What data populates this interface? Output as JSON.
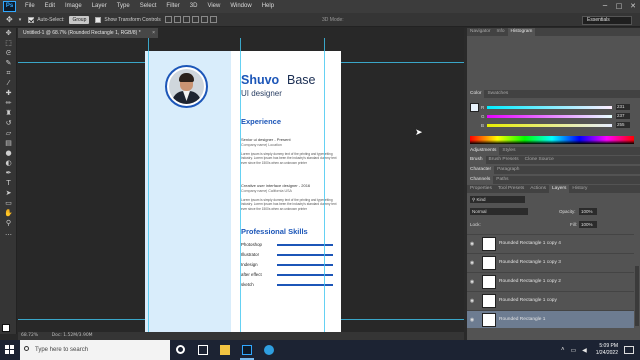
{
  "app": {
    "logo": "Ps"
  },
  "menubar": {
    "items": [
      "File",
      "Edit",
      "Image",
      "Layer",
      "Type",
      "Select",
      "Filter",
      "3D",
      "View",
      "Window",
      "Help"
    ]
  },
  "window_controls": [
    "─",
    "□",
    "✕"
  ],
  "options_bar": {
    "auto_select_label": "Auto-Select:",
    "auto_select_value": "Group",
    "transform_label": "Show Transform Controls",
    "mode_3d_label": "3D Mode:",
    "workspace": "Essentials"
  },
  "document": {
    "tab_title": "Untitled-1 @ 68.7% (Rounded Rectangle 1, RGB/8) *",
    "close_glyph": "×"
  },
  "resume": {
    "name_first": "Shuvo",
    "name_last": "Base",
    "role": "UI designer",
    "experience_title": "Experience",
    "job1": {
      "title": "Senior ui designer - Present",
      "company": "Company name| Location",
      "desc": "Lorem ipsum is simply dummy text of the printing and typesetting industry. Lorem Ipsum has been the industry's standard dummy text ever since the 1500s when an unknown printer"
    },
    "job2": {
      "title": "Creative user interface designer - 2016",
      "company": "Company name| California USA",
      "desc": "Lorem ipsum is simply dummy text of the printing and typesetting industry. Lorem Ipsum has been the industry's standard dummy text ever since the 1500s when an unknown printer"
    },
    "skills_title": "Professional Skills",
    "skills": [
      {
        "label": "Photoshop",
        "level": 1.0
      },
      {
        "label": "Illustrator",
        "level": 1.0
      },
      {
        "label": "Indesign",
        "level": 1.0
      },
      {
        "label": "after effect",
        "level": 1.0
      },
      {
        "label": "sketch",
        "level": 1.0
      }
    ],
    "colors": {
      "accent": "#1c56b8",
      "sidebar": "#d9edfb"
    }
  },
  "status_bar": {
    "zoom": "68.72%",
    "doc_size": "Doc: 1.52M/3.90M"
  },
  "panels": {
    "navigator_tabs": [
      "Navigator",
      "Info",
      "Histogram"
    ],
    "color_tabs": [
      "Color",
      "Swatches"
    ],
    "color_values": {
      "r": "231",
      "g": "237",
      "b": "255"
    },
    "adjustments_tabs": [
      "Adjustments",
      "Styles"
    ],
    "brush_tabs": [
      "Brush",
      "Brush Presets",
      "Clone Source"
    ],
    "character_tabs": [
      "Character",
      "Paragraph"
    ],
    "channels_tabs": [
      "Channels",
      "Paths"
    ],
    "layers_tabs": [
      "Properties",
      "Tool Presets",
      "Actions",
      "Layers",
      "History"
    ],
    "layers_filter": "Kind",
    "blend_mode": "Normal",
    "opacity_label": "Opacity:",
    "opacity_value": "100%",
    "lock_label": "Lock:",
    "fill_label": "Fill:",
    "fill_value": "100%",
    "layers": [
      "Rounded Rectangle 1 copy 4",
      "Rounded Rectangle 1 copy 3",
      "Rounded Rectangle 1 copy 2",
      "Rounded Rectangle 1 copy",
      "Rounded Rectangle 1"
    ]
  },
  "taskbar": {
    "search_placeholder": "Type here to search",
    "time": "5:09 PM",
    "date": "1/24/2022"
  }
}
